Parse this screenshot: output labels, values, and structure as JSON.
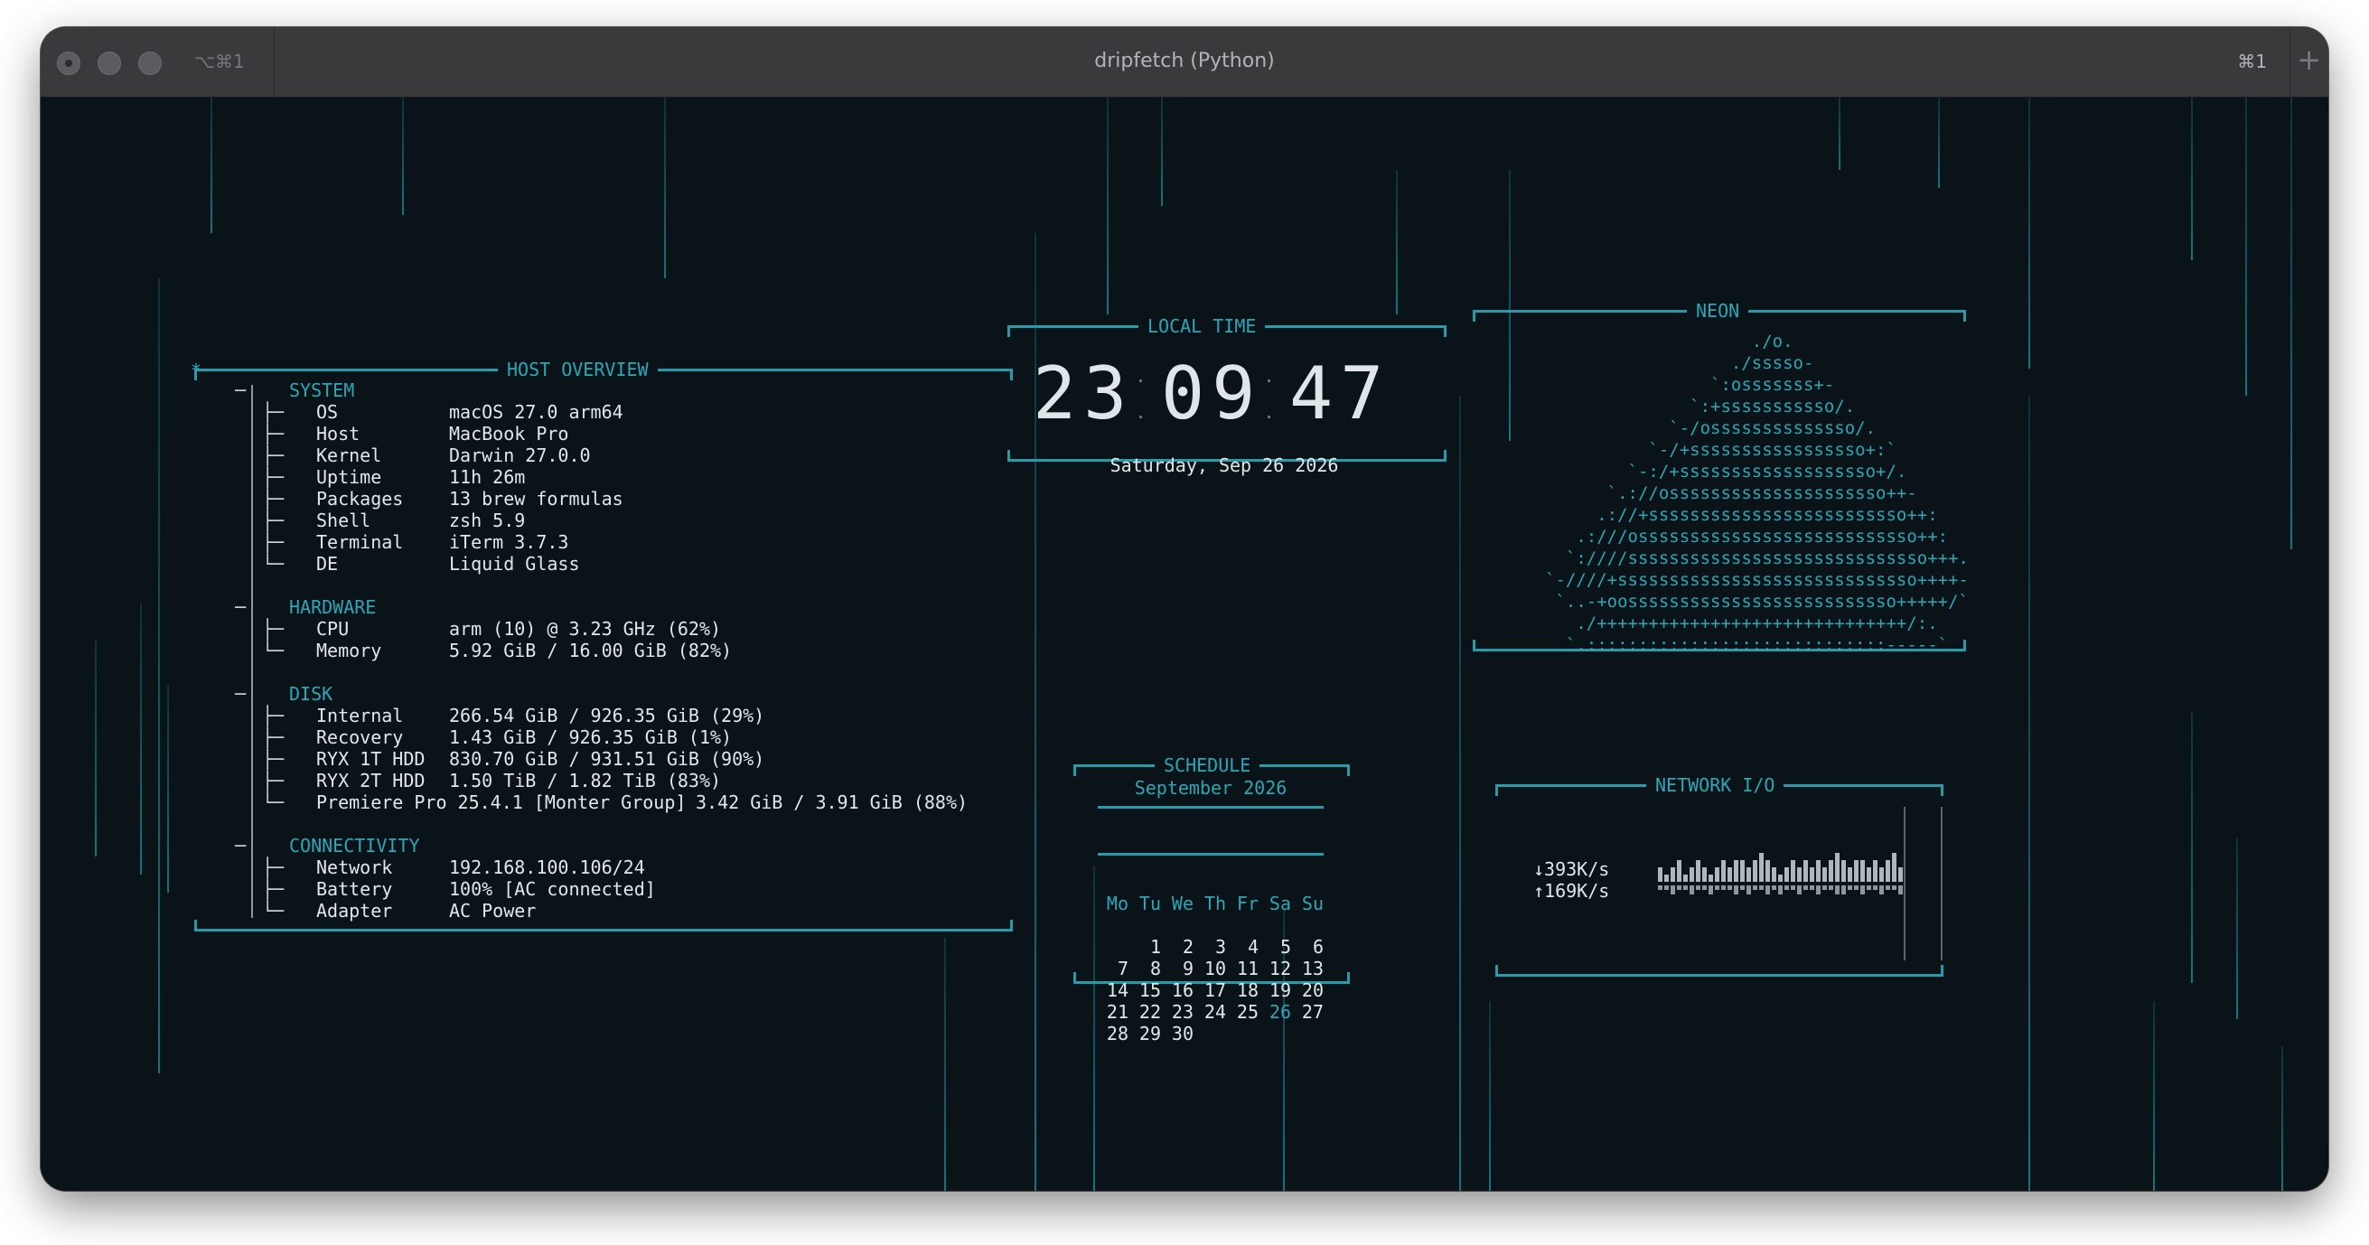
{
  "window": {
    "title": "dripfetch (Python)",
    "left_shortcut": "⌥⌘1",
    "right_shortcut": "⌘1",
    "new_tab": "+"
  },
  "host_overview": {
    "title": "HOST OVERVIEW",
    "marker": "*",
    "sections": [
      {
        "name": "SYSTEM",
        "rows": [
          [
            "OS",
            "macOS 27.0 arm64"
          ],
          [
            "Host",
            "MacBook Pro"
          ],
          [
            "Kernel",
            "Darwin 27.0.0"
          ],
          [
            "Uptime",
            "11h 26m"
          ],
          [
            "Packages",
            "13 brew formulas"
          ],
          [
            "Shell",
            "zsh 5.9"
          ],
          [
            "Terminal",
            "iTerm 3.7.3"
          ],
          [
            "DE",
            "Liquid Glass"
          ]
        ]
      },
      {
        "name": "HARDWARE",
        "rows": [
          [
            "CPU",
            "arm (10) @ 3.23 GHz (62%)"
          ],
          [
            "Memory",
            "5.92 GiB / 16.00 GiB (82%)"
          ]
        ]
      },
      {
        "name": "DISK",
        "rows": [
          [
            "Internal",
            "266.54 GiB / 926.35 GiB (29%)"
          ],
          [
            "Recovery",
            "1.43 GiB / 926.35 GiB (1%)"
          ],
          [
            "RYX 1T HDD",
            "830.70 GiB / 931.51 GiB (90%)"
          ],
          [
            "RYX 2T HDD",
            "1.50 TiB / 1.82 TiB (83%)"
          ],
          [
            "Premiere Pro 25.4.1 [Monter Group]",
            "3.42 GiB / 3.91 GiB (88%)"
          ]
        ]
      },
      {
        "name": "CONNECTIVITY",
        "rows": [
          [
            "Network",
            "192.168.100.106/24"
          ],
          [
            "Battery",
            "100% [AC connected]"
          ],
          [
            "Adapter",
            "AC Power"
          ]
        ]
      }
    ]
  },
  "clock": {
    "title": "LOCAL TIME",
    "hh": "23",
    "mm": "09",
    "ss": "47",
    "date": "Saturday, Sep 26 2026"
  },
  "schedule": {
    "title": "SCHEDULE",
    "month": "September 2026",
    "weekdays": [
      "Mo",
      "Tu",
      "We",
      "Th",
      "Fr",
      "Sa",
      "Su"
    ],
    "weeks": [
      [
        "",
        "1",
        "2",
        "3",
        "4",
        "5",
        "6"
      ],
      [
        "7",
        "8",
        "9",
        "10",
        "11",
        "12",
        "13"
      ],
      [
        "14",
        "15",
        "16",
        "17",
        "18",
        "19",
        "20"
      ],
      [
        "21",
        "22",
        "23",
        "24",
        "25",
        "26",
        "27"
      ],
      [
        "28",
        "29",
        "30",
        "",
        "",
        "",
        ""
      ]
    ],
    "today": "26"
  },
  "neon": {
    "title": "NEON",
    "art": [
      "                    ./o.",
      "                  ./sssso-",
      "                `:osssssss+-",
      "              `:+sssssssssso/.",
      "            `-/ossssssssssssso/.",
      "          `-/+sssssssssssssssso+:`",
      "        `-:/+sssssssssssssssssso+/.",
      "      `.://osssssssssssssssssssso++-",
      "     .://+sssssssssssssssssssssssso++:",
      "   .:///osssssssssssssssssssssssssso++:",
      "  `:////sssssssssssssssssssssssssssso+++.",
      "`-////+sssssssssssssssssssssssssssso++++-",
      " `..-+oossssssssssssssssssssssssso+++++/`",
      "   ./++++++++++++++++++++++++++++++/:.",
      "  `.:::::::::::::::::::::::::::::-----`"
    ]
  },
  "network": {
    "title": "NETWORK I/O",
    "down": "↓393K/s",
    "up": "↑169K/s",
    "down_history": [
      2,
      1,
      2,
      3,
      1,
      2,
      3,
      2,
      1,
      2,
      3,
      2,
      3,
      3,
      2,
      3,
      4,
      3,
      2,
      1,
      2,
      3,
      2,
      3,
      2,
      3,
      2,
      3,
      4,
      3,
      2,
      3,
      3,
      2,
      3,
      2,
      3,
      4,
      2
    ],
    "up_history": [
      1,
      1,
      2,
      1,
      1,
      2,
      1,
      1,
      2,
      1,
      1,
      1,
      2,
      1,
      2,
      1,
      1,
      2,
      1,
      2,
      1,
      1,
      2,
      1,
      1,
      2,
      1,
      1,
      2,
      2,
      1,
      1,
      2,
      1,
      1,
      2,
      1,
      1,
      2
    ]
  },
  "colors": {
    "accent": "#2ba7b8",
    "background": "#091318",
    "text": "#e3e7ea"
  }
}
